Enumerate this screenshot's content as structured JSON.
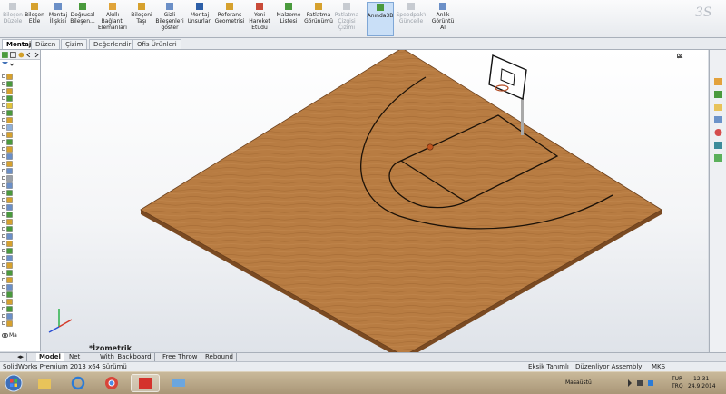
{
  "toolbar": {
    "buttons": [
      {
        "label": "Bileşen\nDüzele",
        "disabled": true
      },
      {
        "label": "Bileşen\nEkle",
        "disabled": false
      },
      {
        "label": "Montaj\nİlişkisi",
        "disabled": false
      },
      {
        "label": "Doğrusal\nBileşen...",
        "disabled": false
      },
      {
        "label": "Akıllı\nBağlantı\nElemanları",
        "disabled": false
      },
      {
        "label": "Bileşeni\nTaşı",
        "disabled": false
      },
      {
        "label": "Gizli\nBileşenleri\ngöster",
        "disabled": false
      },
      {
        "label": "Montaj\nUnsurları",
        "disabled": false
      },
      {
        "label": "Referans\nGeometrisi",
        "disabled": false
      },
      {
        "label": "Yeni\nHareket\nEtüdü",
        "disabled": false
      },
      {
        "label": "Malzeme\nListesi",
        "disabled": false
      },
      {
        "label": "Patlatma\nGörünümü",
        "disabled": false
      },
      {
        "label": "Patlatma\nÇizgisi\nÇizimi",
        "disabled": true
      },
      {
        "label": "Anında3B",
        "disabled": false,
        "active": true
      },
      {
        "label": "Speedpak'ı\nGüncelle",
        "disabled": true
      },
      {
        "label": "Anlık\nGörüntü\nAl",
        "disabled": false
      }
    ]
  },
  "tabs": [
    "Montaj",
    "Düzen",
    "Çizim",
    "Değerlendir",
    "Ofis Ürünleri"
  ],
  "feature_tree": {
    "bottom_label": "Ma"
  },
  "graphics": {
    "view_name": "*İzometrik",
    "triad": {
      "x": "X",
      "y": "Y",
      "z": "Z"
    }
  },
  "bottom_tabs": [
    "Model",
    "Net",
    "With_Backboard",
    "Free Throw",
    "Rebound"
  ],
  "status": {
    "app": "SolidWorks Premium 2013 x64 Sürümü",
    "definition": "Eksik Tanımlı",
    "mode": "Düzenliyor Assembly",
    "units": "MKS"
  },
  "taskbar": {
    "desktop_label": "Masaüstü",
    "lang": "TUR",
    "lang2": "TRQ",
    "time": "12:31",
    "date": "24.9.2014"
  },
  "colors": {
    "floor": "#b5793f",
    "floor_edge": "#7a4a22",
    "line": "#1c1208",
    "accent": "#c9dff7"
  }
}
